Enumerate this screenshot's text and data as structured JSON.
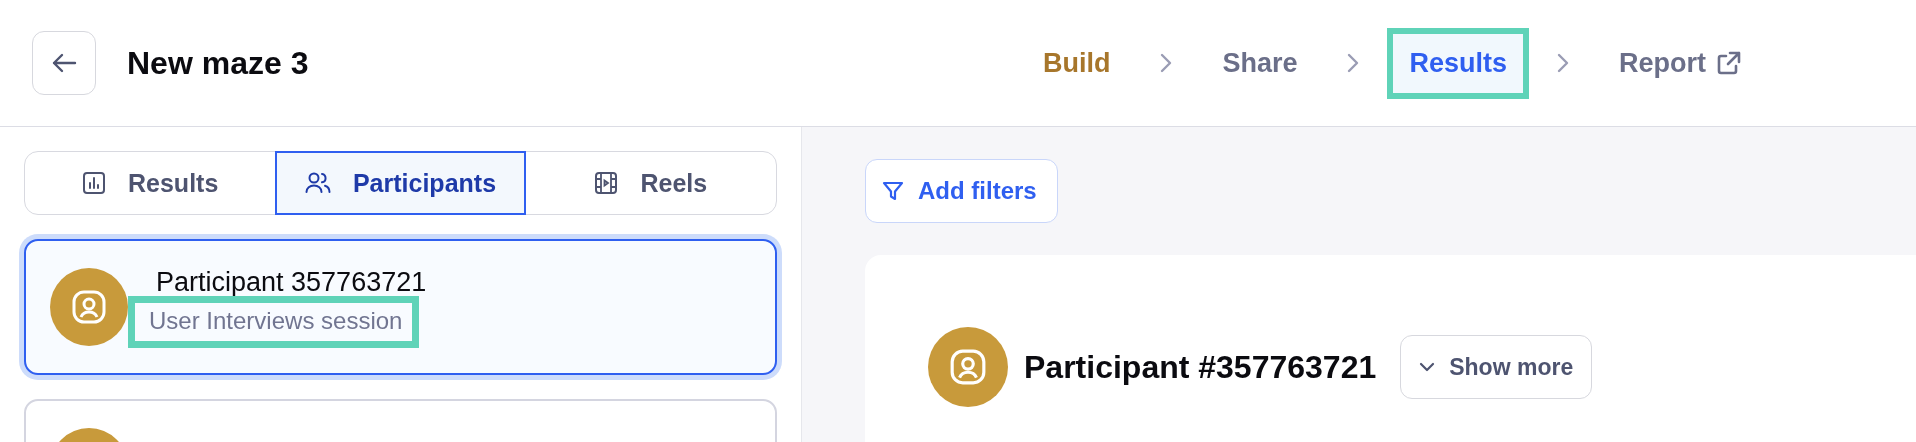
{
  "header": {
    "title": "New maze 3",
    "steps": [
      {
        "label": "Build",
        "kind": "done",
        "selected": false,
        "highlighted": false,
        "external": false
      },
      {
        "label": "Share",
        "kind": "todo",
        "selected": false,
        "highlighted": false,
        "external": false
      },
      {
        "label": "Results",
        "kind": "todo",
        "selected": true,
        "highlighted": true,
        "external": false
      },
      {
        "label": "Report",
        "kind": "todo",
        "selected": false,
        "highlighted": false,
        "external": true
      }
    ]
  },
  "sidebar": {
    "tabs": [
      {
        "label": "Results",
        "kind": "chart",
        "selected": false
      },
      {
        "label": "Participants",
        "kind": "people",
        "selected": true
      },
      {
        "label": "Reels",
        "kind": "film",
        "selected": false
      }
    ],
    "participants": [
      {
        "name": "Participant 357763721",
        "subtitle": "User Interviews session",
        "selected": true,
        "subtitle_highlighted": true
      },
      {
        "selected": false
      }
    ]
  },
  "main": {
    "filter_button": "Add filters",
    "participant_title": "Participant #357763721",
    "show_more": "Show more"
  }
}
